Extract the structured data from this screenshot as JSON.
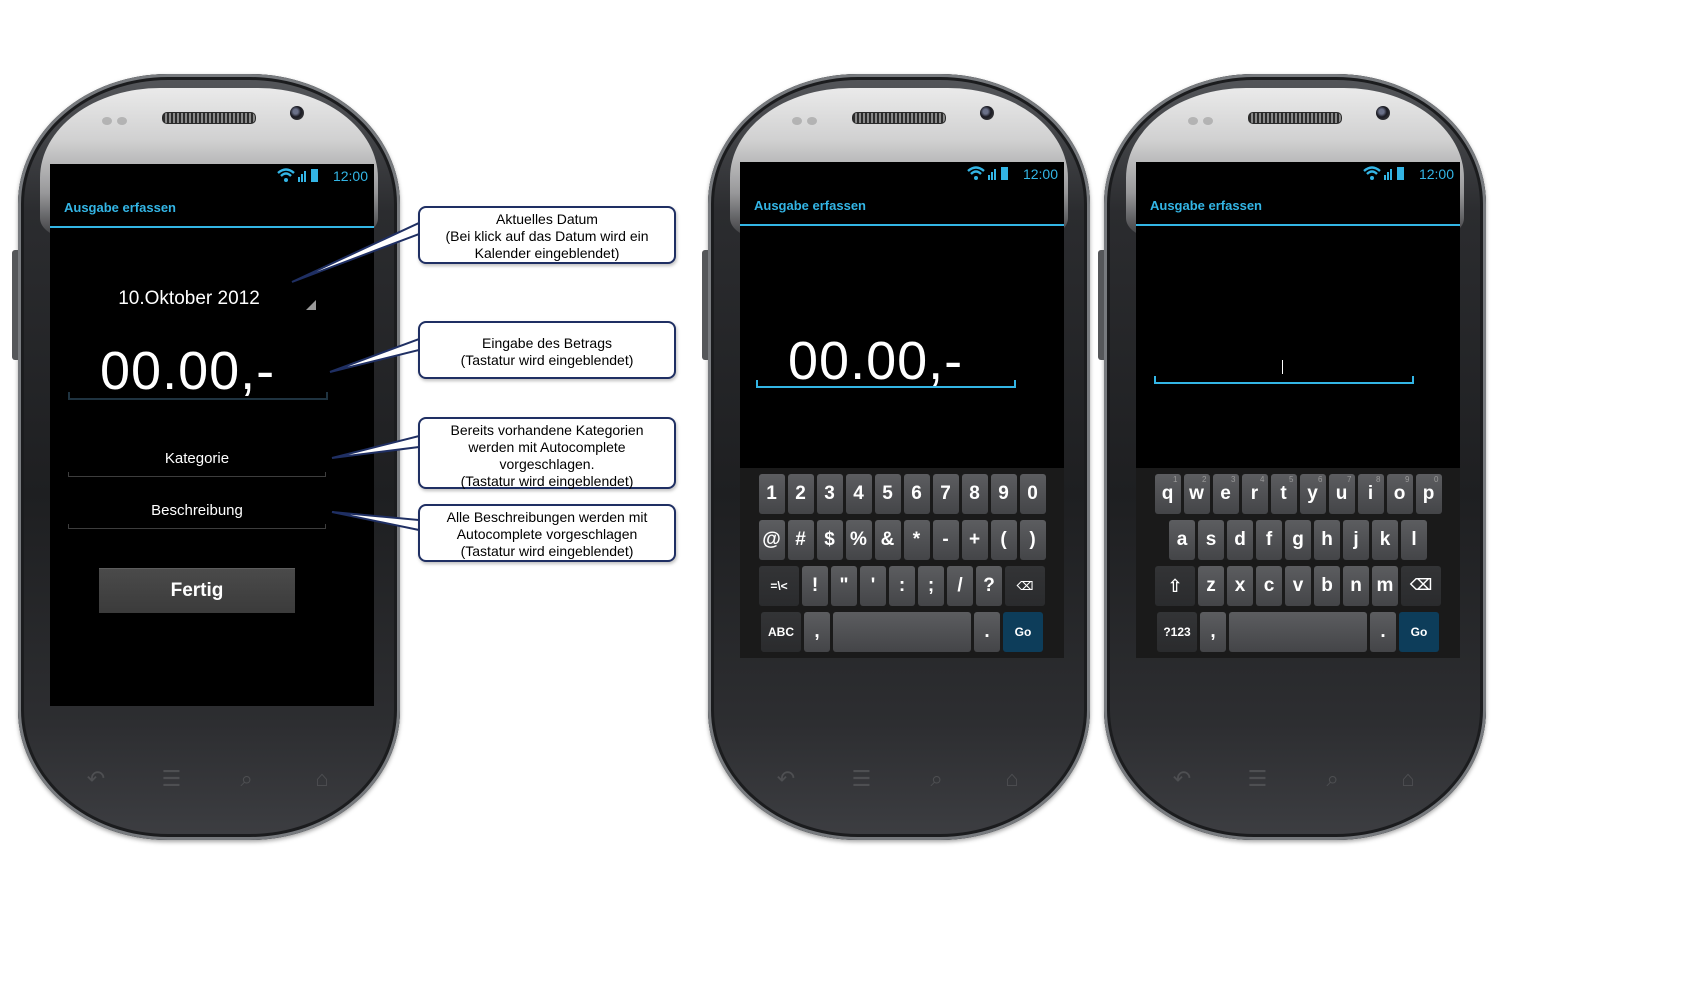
{
  "app": {
    "title": "Ausgabe erfassen",
    "status_time": "12:00"
  },
  "screen1": {
    "date": "10.Oktober 2012",
    "amount": "00.00,-",
    "category_placeholder": "Kategorie",
    "description_placeholder": "Beschreibung",
    "done_button": "Fertig"
  },
  "screen2": {
    "amount": "00.00,-",
    "keyboard": {
      "row1": [
        "1",
        "2",
        "3",
        "4",
        "5",
        "6",
        "7",
        "8",
        "9",
        "0"
      ],
      "row2": [
        "@",
        "#",
        "$",
        "%",
        "&",
        "*",
        "-",
        "+",
        "(",
        ")"
      ],
      "row3": [
        "=\\<",
        "!",
        "\"",
        "'",
        ":",
        ";",
        "/",
        "?"
      ],
      "row4": [
        "ABC",
        ",",
        ".",
        "Go"
      ]
    }
  },
  "screen3": {
    "keyboard": {
      "row1": [
        "q",
        "w",
        "e",
        "r",
        "t",
        "y",
        "u",
        "i",
        "o",
        "p"
      ],
      "row1_hints": [
        "1",
        "2",
        "3",
        "4",
        "5",
        "6",
        "7",
        "8",
        "9",
        "0"
      ],
      "row2": [
        "a",
        "s",
        "d",
        "f",
        "g",
        "h",
        "j",
        "k",
        "l"
      ],
      "row3": [
        "z",
        "x",
        "c",
        "v",
        "b",
        "n",
        "m"
      ],
      "row4": [
        "?123",
        ",",
        ".",
        "Go"
      ]
    }
  },
  "callouts": [
    {
      "lines": [
        "Aktuelles Datum",
        "(Bei klick auf das Datum wird ein",
        "Kalender eingeblendet)"
      ]
    },
    {
      "lines": [
        "Eingabe des Betrags",
        "(Tastatur wird eingeblendet)"
      ]
    },
    {
      "lines": [
        "Bereits vorhandene Kategorien",
        "werden mit Autocomplete",
        "vorgeschlagen.",
        "(Tastatur wird eingeblendet)"
      ]
    },
    {
      "lines": [
        "Alle Beschreibungen werden mit",
        "Autocomplete vorgeschlagen",
        "(Tastatur wird eingeblendet)"
      ]
    }
  ],
  "icons": {
    "statusbar": [
      "wifi-icon",
      "signal-icon",
      "battery-icon"
    ],
    "navigation": [
      "back-icon",
      "recent-apps-icon",
      "search-icon",
      "home-icon"
    ],
    "keyboard": [
      "backspace-icon",
      "shift-icon"
    ]
  },
  "colors": {
    "accent": "#33b5e5",
    "screen_bg": "#000000",
    "callout_border": "#1f2f63",
    "go_key": "#0d3d5a"
  }
}
